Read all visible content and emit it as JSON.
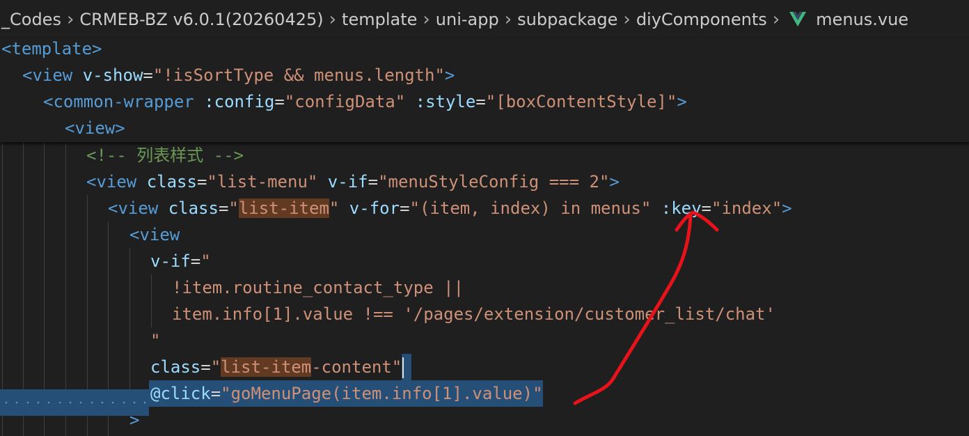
{
  "breadcrumb": {
    "items": [
      "_Codes",
      "CRMEB-BZ v6.0.1(20260425)",
      "template",
      "uni-app",
      "subpackage",
      "diyComponents"
    ],
    "file": "menus.vue",
    "file_icon": "vue-icon"
  },
  "sticky": {
    "l1": {
      "t1": "<template>"
    },
    "l2": {
      "t1": "<view",
      "a1": " v-show",
      "p1": "=",
      "s1": "\"!isSortType && menus.length\"",
      "t2": ">"
    },
    "l3": {
      "t1": "<common-wrapper",
      "a1": " :config",
      "p1": "=",
      "s1": "\"configData\"",
      "a2": " :style",
      "p2": "=",
      "s2": "\"[boxContentStyle]\"",
      "t2": ">"
    },
    "l4": {
      "t1": "<view>"
    }
  },
  "code": {
    "l5": {
      "c1": "<!-- 列表样式 -->"
    },
    "l6": {
      "t1": "<view",
      "a1": " class",
      "p1": "=",
      "s1": "\"list-menu\"",
      "a2": " v-if",
      "p2": "=",
      "s2": "\"menuStyleConfig === 2\"",
      "t2": ">"
    },
    "l7": {
      "t1": "<view",
      "a1": " class",
      "p1": "=",
      "s1a": "\"",
      "s1h": "list-item",
      "s1b": "\"",
      "a2": " v-for",
      "p2": "=",
      "s2": "\"(item, index) in menus\"",
      "a3": " :key",
      "p3": "=",
      "s3": "\"index\"",
      "t2": ">"
    },
    "l8": {
      "t1": "<view"
    },
    "l9": {
      "a1": "v-if",
      "p1": "=",
      "s1": "\""
    },
    "l10": {
      "s1": "!item.routine_contact_type ||"
    },
    "l11": {
      "s1": "item.info[1].value !== '/pages/extension/customer_list/chat'"
    },
    "l12": {
      "s1": "\""
    },
    "l13": {
      "a1": "class",
      "p1": "=",
      "s1a": "\"",
      "s1h": "list-item",
      "s1b": "-content\""
    },
    "l14": {
      "a1": "@click",
      "p1": "=",
      "s1": "\"goMenuPage(item.info[1].value)\""
    },
    "l15": {
      "t1": ">"
    }
  },
  "colors": {
    "background": "#1f1f1f",
    "tag": "#569cd6",
    "attribute": "#9cdcfe",
    "string": "#ce9178",
    "comment": "#6a9955",
    "selection": "#264f78",
    "find_highlight": "#613a21",
    "annotation_arrow": "#e8121a"
  }
}
